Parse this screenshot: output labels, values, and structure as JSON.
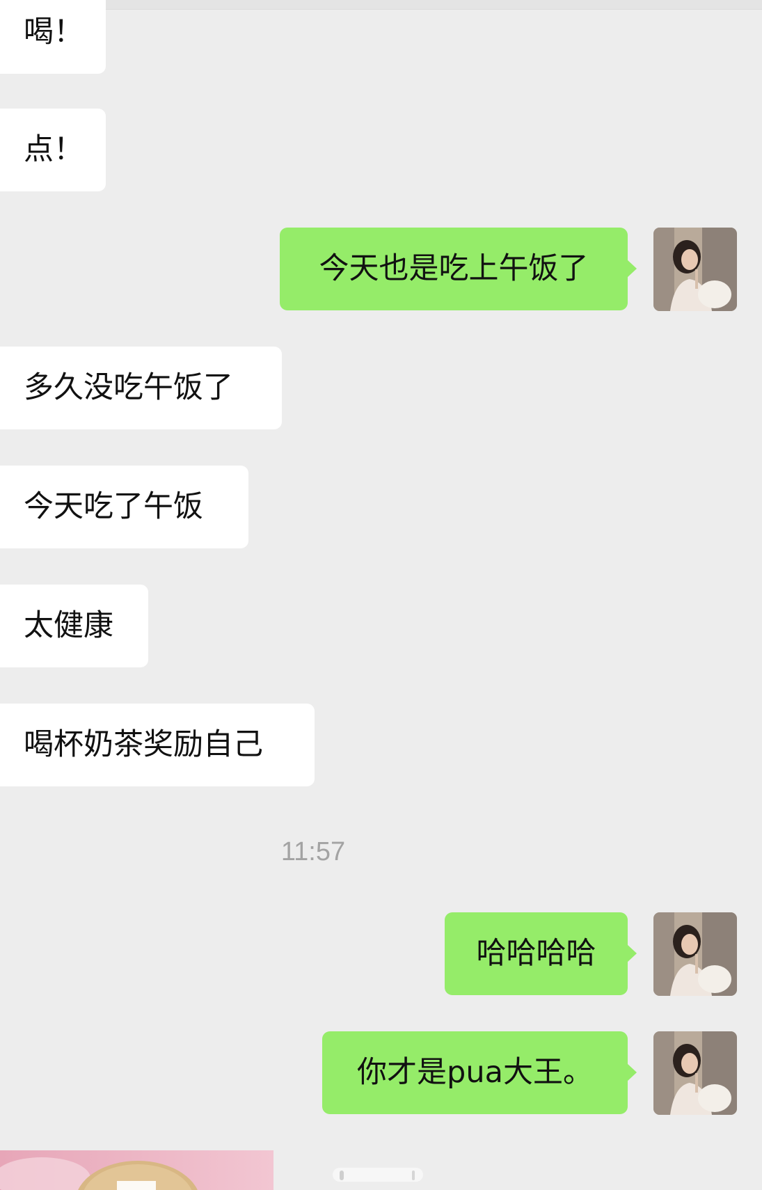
{
  "chat": {
    "messages": [
      {
        "side": "left",
        "text": "喝！"
      },
      {
        "side": "left",
        "text": "点！"
      },
      {
        "side": "right",
        "text": "今天也是吃上午饭了"
      },
      {
        "side": "left",
        "text": "多久没吃午饭了"
      },
      {
        "side": "left",
        "text": "今天吃了午饭"
      },
      {
        "side": "left",
        "text": "太健康"
      },
      {
        "side": "left",
        "text": "喝杯奶茶奖励自己"
      },
      {
        "side": "right",
        "text": "哈哈哈哈"
      },
      {
        "side": "right",
        "text": "你才是pua大王。"
      }
    ],
    "timestamp": "11:57"
  },
  "colors": {
    "background": "#ededed",
    "incoming_bubble": "#ffffff",
    "outgoing_bubble": "#95ec69",
    "timestamp_text": "#a3a3a3"
  },
  "icons": {
    "avatar": "user-avatar-photo",
    "thumbnail": "image-message-thumbnail"
  }
}
